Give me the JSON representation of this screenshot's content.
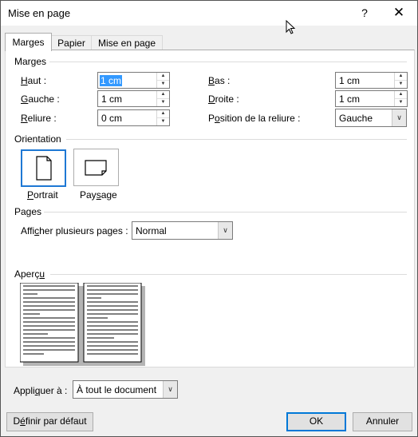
{
  "window": {
    "title": "Mise en page",
    "help_label": "?",
    "close_label": "✕"
  },
  "tabs": [
    {
      "label": "Marges"
    },
    {
      "label": "Papier"
    },
    {
      "label": "Mise en page"
    }
  ],
  "margins": {
    "group_label": "Marges",
    "top": {
      "label_u": "H",
      "label_rest": "aut :",
      "value": "1 cm"
    },
    "left": {
      "label_u": "G",
      "label_rest": "auche :",
      "value": "1 cm"
    },
    "gutter": {
      "label_u": "R",
      "label_rest": "eliure :",
      "value": "0 cm"
    },
    "bottom": {
      "label_u": "B",
      "label_rest": "as :",
      "value": "1 cm"
    },
    "right": {
      "label_u": "D",
      "label_rest": "roite :",
      "value": "1 cm"
    },
    "gutter_pos": {
      "label_pre": "P",
      "label_u": "o",
      "label_rest": "sition de la reliure :",
      "value": "Gauche"
    }
  },
  "orientation": {
    "group_label": "Orientation",
    "portrait": {
      "label_u": "P",
      "label_rest": "ortrait"
    },
    "landscape": {
      "label_pre": "Pay",
      "label_u": "s",
      "label_rest": "age"
    }
  },
  "pages": {
    "group_label": "Pages",
    "multi_label_pre": "Affi",
    "multi_label_u": "c",
    "multi_label_rest": "her plusieurs pages :",
    "multi_value": "Normal"
  },
  "preview": {
    "group_label_pre": "Aperç",
    "group_label_u": "u"
  },
  "apply": {
    "label_pre": "Appli",
    "label_u": "q",
    "label_rest": "uer à :",
    "value": "À tout le document"
  },
  "footer": {
    "default_pre": "D",
    "default_u": "é",
    "default_rest": "finir par défaut",
    "ok_label": "OK",
    "cancel_label": "Annuler"
  },
  "colors": {
    "accent": "#0078d7",
    "selection": "#3399ff"
  },
  "icons": {
    "cursor": "mouse-pointer-icon",
    "portrait": "portrait-page-icon",
    "landscape": "landscape-page-icon"
  }
}
